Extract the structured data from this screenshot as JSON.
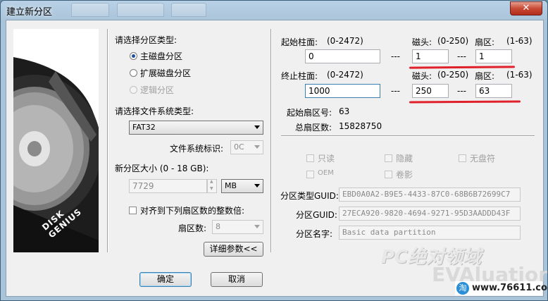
{
  "window": {
    "title": "建立新分区",
    "close_glyph": "✕"
  },
  "disk_image": {
    "brand_text": "DISK GENIUS"
  },
  "partition_type": {
    "heading": "请选择分区类型:",
    "options": [
      {
        "label": "主磁盘分区",
        "selected": true,
        "enabled": true
      },
      {
        "label": "扩展磁盘分区",
        "selected": false,
        "enabled": true
      },
      {
        "label": "逻辑分区",
        "selected": false,
        "enabled": false
      }
    ]
  },
  "filesystem": {
    "heading": "请选择文件系统类型:",
    "value": "FAT32",
    "id_label": "文件系统标识:",
    "id_value": "0C"
  },
  "size": {
    "label": "新分区大小 (0 - 18 GB):",
    "value": "7729",
    "unit": "MB"
  },
  "align": {
    "label": "对齐到下列扇区数的整数倍:",
    "sectors_label": "扇区数:",
    "sectors_value": "8"
  },
  "details_button": "详细参数<<",
  "start": {
    "cylinder_label": "起始柱面:",
    "cylinder_range": "(0-2472)",
    "cylinder_value": "0",
    "head_label": "磁头:",
    "head_range": "(0-250)",
    "head_value": "1",
    "sector_label": "扇区:",
    "sector_range": "(1-63)",
    "sector_value": "1"
  },
  "end": {
    "cylinder_label": "终止柱面:",
    "cylinder_range": "(0-2472)",
    "cylinder_value": "1000",
    "head_label": "磁头:",
    "head_range": "(0-250)",
    "head_value": "250",
    "sector_label": "扇区:",
    "sector_range": "(1-63)",
    "sector_value": "63"
  },
  "separator": "---",
  "info": {
    "start_sector_label": "起始扇区号:",
    "start_sector_value": "63",
    "total_sectors_label": "总扇区数:",
    "total_sectors_value": "15828750"
  },
  "attributes": {
    "readonly": "只读",
    "hidden": "隐藏",
    "no_drive_letter": "无盘符",
    "oem": "OEM",
    "shadow": "卷影"
  },
  "guid": {
    "type_label": "分区类型GUID:",
    "type_value": "EBD0A0A2-B9E5-4433-87C0-68B6B72699C7",
    "part_label": "分区GUID:",
    "part_value": "27ECA920-9820-4694-9271-95D3AADDD43F",
    "name_label": "分区名字:",
    "name_value": "Basic data partition"
  },
  "buttons": {
    "ok": "确定",
    "cancel": "取消"
  },
  "watermark": {
    "line1": "PC绝对领域",
    "line2": "EVAluation",
    "url": "www.76611.com",
    "badge": "淘"
  },
  "colors": {
    "annotation_red": "#e0202a",
    "accent_blue": "#1e4f9c"
  }
}
